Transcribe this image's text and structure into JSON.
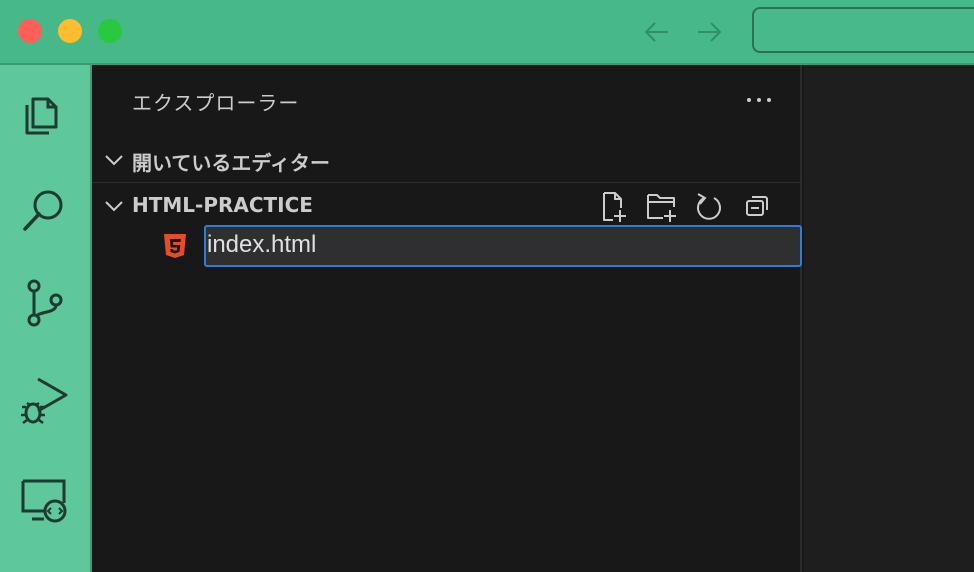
{
  "sidebar": {
    "title": "エクスプローラー",
    "sections": {
      "open_editors": {
        "label": "開いているエディター"
      },
      "project": {
        "label": "HTML-PRACTICE"
      }
    },
    "files": [
      {
        "name": "index.html",
        "icon": "html5-icon"
      }
    ]
  },
  "activity_bar": {
    "items": [
      "explorer-icon",
      "search-icon",
      "source-control-icon",
      "run-debug-icon",
      "remote-explorer-icon"
    ]
  },
  "colors": {
    "titlebar": "#47b888",
    "activity_bar": "#5ec79b",
    "sidebar_bg": "#181818",
    "focus_border": "#2b7fd9",
    "html5": "#e44d26"
  }
}
